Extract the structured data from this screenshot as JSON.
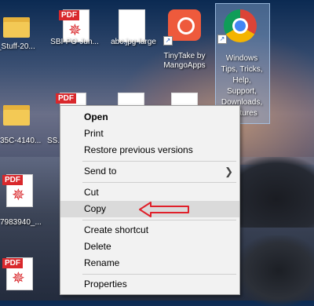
{
  "desktop": {
    "icons": [
      {
        "label": "_Stuff-20..."
      },
      {
        "label": "SBI-PO-Jun..."
      },
      {
        "label": "abc.jpg-large"
      },
      {
        "label": "TinyTake by MangoApps"
      },
      {
        "label": "Windows Tips, Tricks, Help, Support, Downloads, Features"
      },
      {
        "label": "35C-4140..."
      },
      {
        "label": "SS..."
      },
      {
        "label": "7983940_..."
      }
    ],
    "pdf_tag": "PDF"
  },
  "context_menu": {
    "items": [
      {
        "label": "Open",
        "bold": true
      },
      {
        "label": "Print"
      },
      {
        "label": "Restore previous versions"
      },
      {
        "label": "Send to",
        "submenu": true
      },
      {
        "label": "Cut"
      },
      {
        "label": "Copy",
        "highlighted": true
      },
      {
        "label": "Create shortcut"
      },
      {
        "label": "Delete"
      },
      {
        "label": "Rename"
      },
      {
        "label": "Properties"
      }
    ]
  },
  "annotation": {
    "arrow_color": "#e0202a"
  }
}
